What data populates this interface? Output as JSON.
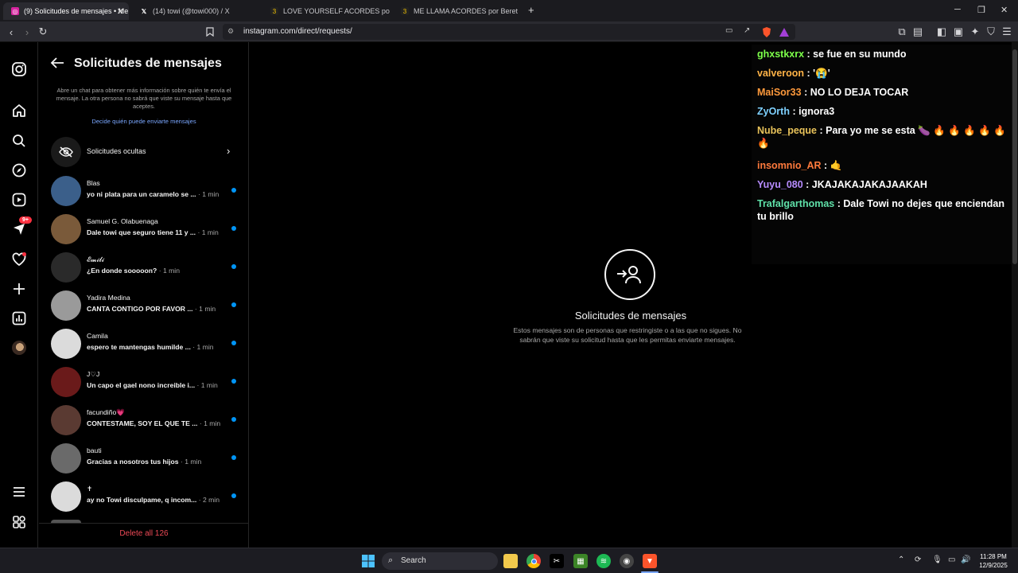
{
  "browser": {
    "tabs": [
      {
        "title": "(9) Solicitudes de mensajes • Me",
        "active": true
      },
      {
        "title": "(14) towi (@towi000) / X",
        "active": false
      },
      {
        "title": "LOVE YOURSELF ACORDES por Justin",
        "active": false
      },
      {
        "title": "ME LLAMA ACORDES por Beret @ Ul",
        "active": false
      }
    ],
    "new_tab": "+",
    "url": "instagram.com/direct/requests/"
  },
  "rail": {
    "notification_badge": "9+"
  },
  "requests_panel": {
    "title": "Solicitudes de mensajes",
    "description": "Abre un chat para obtener más información sobre quién te envía el mensaje. La otra persona no sabrá que viste su mensaje hasta que aceptes.",
    "link": "Decide quién puede enviarte mensajes",
    "hidden_requests": "Solicitudes ocultas",
    "items": [
      {
        "name": "Blas",
        "message": "yo ni plata para un caramelo se ...",
        "time": "· 1 min",
        "color": "#3b5f8a"
      },
      {
        "name": "Samuel G. Olabuenaga",
        "message": "Dale towi que seguro tiene 11 y ...",
        "time": "· 1 min",
        "color": "#7a5a3a"
      },
      {
        "name": "𝓔𝓶𝓲𝓵𝓲",
        "message": "¿En donde sooooon?",
        "time": "· 1 min",
        "color": "#2a2a2a"
      },
      {
        "name": "Yadira Medina",
        "message": "CANTA CONTIGO POR FAVOR ...",
        "time": "· 1 min",
        "color": "#9a9a9a"
      },
      {
        "name": "Camila",
        "message": "espero te mantengas humilde ...",
        "time": "· 1 min",
        "color": "#dbdbdb"
      },
      {
        "name": "J♡J",
        "message": "Un capo el gael nono increible i...",
        "time": "· 1 min",
        "color": "#6a1a1a"
      },
      {
        "name": "facundiño💗",
        "message": "CONTESTAME, SOY EL QUE TE ...",
        "time": "· 1 min",
        "color": "#5a3a32"
      },
      {
        "name": "bauti",
        "message": "Gracias a nosotros tus hijos",
        "time": "· 1 min",
        "color": "#6a6a6a"
      },
      {
        "name": "✝",
        "message": "ay no Towi disculpame, q incom...",
        "time": "· 2 min",
        "color": "#dbdbdb"
      }
    ],
    "delete_all": "Delete all 126"
  },
  "main": {
    "title": "Solicitudes de mensajes",
    "description": "Estos mensajes son de personas que restringiste o a las que no sigues. No sabrán que viste su solicitud hasta que les permitas enviarte mensajes."
  },
  "chat": [
    {
      "user": "ghxstkxrx",
      "text": " : se fue en su mundo",
      "color": "#7cff4a"
    },
    {
      "user": "valveroon",
      "text": " : '😭'",
      "color": "#ffb347"
    },
    {
      "user": "MaiSor33",
      "text": " : NO LO DEJA TOCAR",
      "color": "#ff9a3c"
    },
    {
      "user": "ZyOrth",
      "text": " : ignora3",
      "color": "#7fd1ff"
    },
    {
      "user": "Nube_peque",
      "text": " : Para yo me se esta 🍆 🔥 🔥 🔥 🔥 🔥 🔥",
      "color": "#e8c25a"
    },
    {
      "user": "insomnio_AR",
      "text": " : 🤙",
      "color": "#ff7a3c"
    },
    {
      "user": "Yuyu_080",
      "text": " : JKAJAKAJAKAJAAKAH",
      "color": "#b78cff"
    },
    {
      "user": "Trafalgarthomas",
      "text": " : Dale Towi no dejes que enciendan tu brillo",
      "color": "#5fe0a8"
    }
  ],
  "taskbar": {
    "search": "Search",
    "time": "11:28 PM",
    "date": "12/9/2025"
  },
  "colors": {
    "instagram_blue": "#0095f6",
    "delete_red": "#ed4956",
    "link_blue": "#7aa7ff"
  }
}
